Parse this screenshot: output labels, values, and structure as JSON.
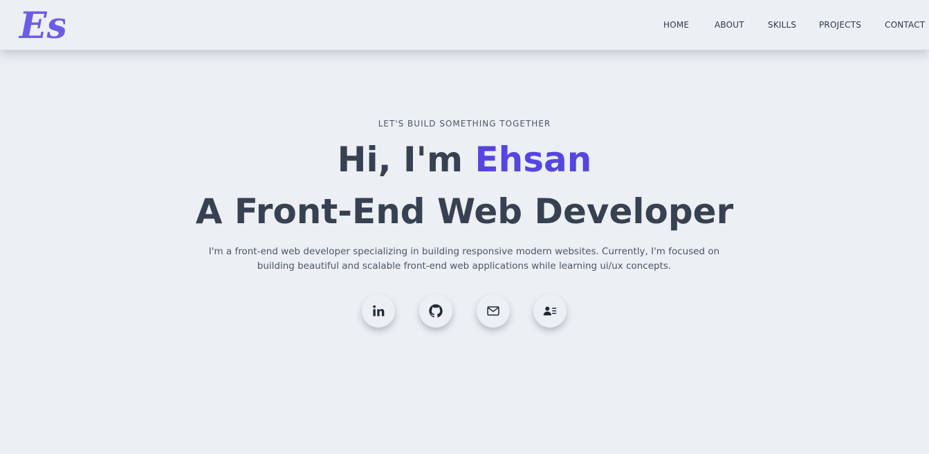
{
  "nav": {
    "links": [
      {
        "label": "HOME"
      },
      {
        "label": "ABOUT"
      },
      {
        "label": "SKILLS"
      },
      {
        "label": "PROJECTS"
      },
      {
        "label": "CONTACT"
      }
    ]
  },
  "logo": {
    "text": "Es"
  },
  "hero": {
    "tagline": "LET'S BUILD SOMETHING TOGETHER",
    "greeting": "Hi, I'm ",
    "name": "Ehsan",
    "title": "A Front-End Web Developer",
    "intro": "I'm a front-end web developer specializing in building responsive modern websites. Currently, I'm focused on building beautiful and scalable front-end web applications while learning ui/ux concepts."
  },
  "socials": [
    {
      "icon": "linkedin-icon"
    },
    {
      "icon": "github-icon"
    },
    {
      "icon": "mail-icon"
    },
    {
      "icon": "contact-card-icon"
    }
  ],
  "colors": {
    "accent": "#5546E0",
    "logo": "#6B5CE7",
    "text": "#374151",
    "background": "#ECEFF3"
  }
}
